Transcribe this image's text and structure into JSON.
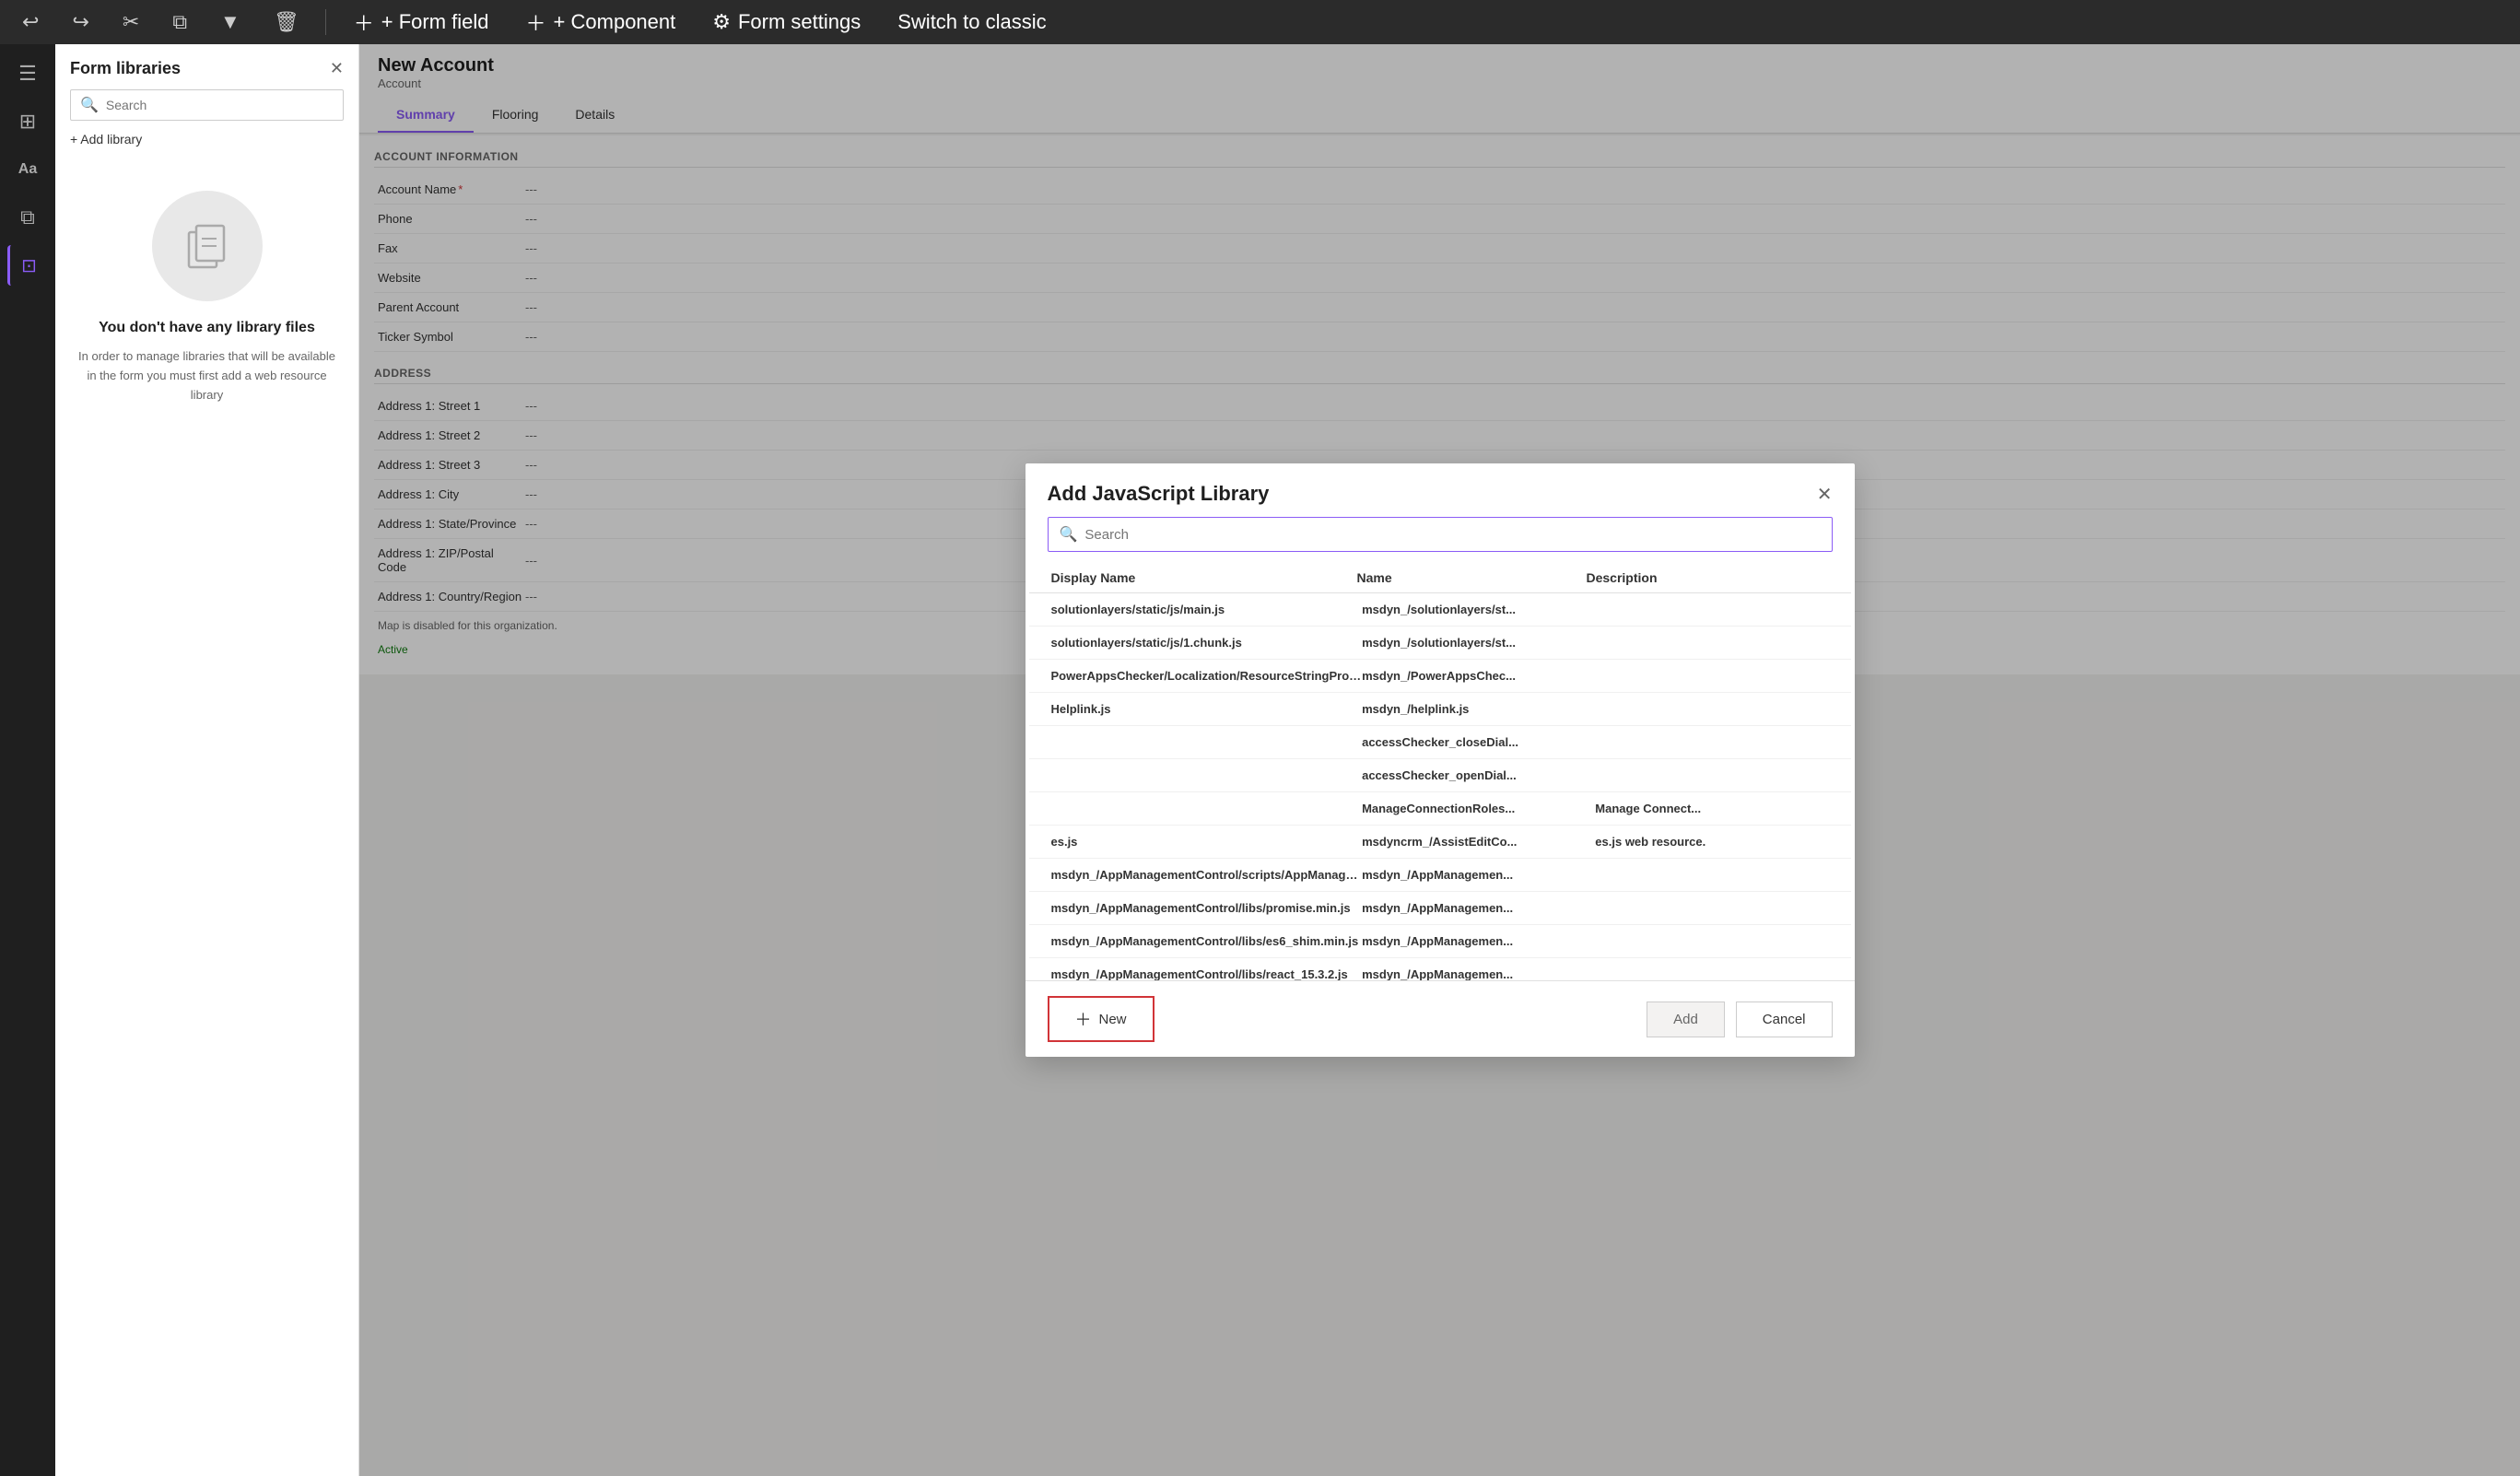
{
  "toolbar": {
    "actions": [
      {
        "label": "+ Form field",
        "name": "form-field-button"
      },
      {
        "label": "+ Component",
        "name": "component-button"
      },
      {
        "label": "Form settings",
        "name": "form-settings-button"
      },
      {
        "label": "Switch to classic",
        "name": "switch-classic-button"
      }
    ]
  },
  "sidebar": {
    "icons": [
      {
        "name": "menu-icon",
        "symbol": "☰"
      },
      {
        "name": "dashboard-icon",
        "symbol": "⊞"
      },
      {
        "name": "text-icon",
        "symbol": "Aa"
      },
      {
        "name": "layers-icon",
        "symbol": "⧉"
      },
      {
        "name": "components-icon",
        "symbol": "⊡"
      }
    ]
  },
  "form_libraries": {
    "title": "Form libraries",
    "search_placeholder": "Search",
    "add_library_label": "+ Add library",
    "empty_title": "You don't have any library files",
    "empty_desc": "In order to manage libraries that will be available in the form you must first add a web resource library"
  },
  "form": {
    "title": "New Account",
    "subtitle": "Account",
    "tabs": [
      "Summary",
      "Flooring",
      "Details"
    ],
    "active_tab": "Summary",
    "sections": {
      "account_info": {
        "header": "ACCOUNT INFORMATION",
        "fields": [
          {
            "label": "Account Name",
            "value": "---",
            "required": true
          },
          {
            "label": "Phone",
            "value": "---"
          },
          {
            "label": "Fax",
            "value": "---"
          },
          {
            "label": "Website",
            "value": "---"
          },
          {
            "label": "Parent Account",
            "value": "---"
          },
          {
            "label": "Ticker Symbol",
            "value": "---"
          }
        ]
      },
      "address": {
        "header": "ADDRESS",
        "fields": [
          {
            "label": "Address 1: Street 1",
            "value": "---"
          },
          {
            "label": "Address 1: Street 2",
            "value": "---"
          },
          {
            "label": "Address 1: Street 3",
            "value": "---"
          },
          {
            "label": "Address 1: City",
            "value": "---"
          },
          {
            "label": "Address 1: State/Province",
            "value": "---"
          },
          {
            "label": "Address 1: ZIP/Postal Code",
            "value": "---"
          },
          {
            "label": "Address 1: Country/Region",
            "value": "---"
          }
        ]
      }
    },
    "map_disabled": "Map is disabled for this organization.",
    "status": "Active"
  },
  "dialog": {
    "title": "Add JavaScript Library",
    "search_placeholder": "Search",
    "columns": {
      "display_name": "Display Name",
      "name": "Name",
      "description": "Description"
    },
    "rows": [
      {
        "display": "solutionlayers/static/js/main.js",
        "name": "msdyn_/solutionlayers/st...",
        "desc": ""
      },
      {
        "display": "solutionlayers/static/js/1.chunk.js",
        "name": "msdyn_/solutionlayers/st...",
        "desc": ""
      },
      {
        "display": "PowerAppsChecker/Localization/ResourceStringProvid...",
        "name": "msdyn_/PowerAppsChec...",
        "desc": ""
      },
      {
        "display": "Helplink.js",
        "name": "msdyn_/helplink.js",
        "desc": ""
      },
      {
        "display": "",
        "name": "accessChecker_closeDial...",
        "desc": ""
      },
      {
        "display": "",
        "name": "accessChecker_openDial...",
        "desc": ""
      },
      {
        "display": "",
        "name": "ManageConnectionRoles...",
        "desc": "Manage Connect..."
      },
      {
        "display": "es.js",
        "name": "msdyncrm_/AssistEditCo...",
        "desc": "es.js web resource."
      },
      {
        "display": "msdyn_/AppManagementControl/scripts/AppManage...",
        "name": "msdyn_/AppManagemen...",
        "desc": ""
      },
      {
        "display": "msdyn_/AppManagementControl/libs/promise.min.js",
        "name": "msdyn_/AppManagemen...",
        "desc": ""
      },
      {
        "display": "msdyn_/AppManagementControl/libs/es6_shim.min.js",
        "name": "msdyn_/AppManagemen...",
        "desc": ""
      },
      {
        "display": "msdyn_/AppManagementControl/libs/react_15.3.2.js",
        "name": "msdyn_/AppManagemen...",
        "desc": ""
      }
    ],
    "buttons": {
      "new": "New",
      "add": "Add",
      "cancel": "Cancel"
    }
  }
}
